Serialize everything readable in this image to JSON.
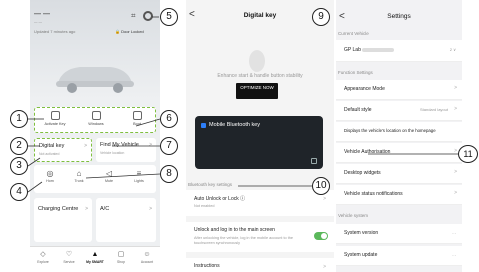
{
  "phone1": {
    "big_title": "— —",
    "subtitle": "— —",
    "updated": "Updated 7 minutes ago",
    "door_status": "Door Locked",
    "quick_actions": [
      {
        "label": "Activate Key",
        "icon": "lock-icon"
      },
      {
        "label": "Windows",
        "icon": "window-icon"
      },
      {
        "label": "Boot",
        "icon": "boot-icon"
      }
    ],
    "digital_key": {
      "title": "Digital key",
      "sub": "Not activated",
      "chevron": ">"
    },
    "find_vehicle": {
      "title": "Find My Vehicle",
      "sub": "Vehicle location",
      "chevron": ">"
    },
    "controls": [
      {
        "label": "Horn",
        "icon": "horn-icon",
        "glyph": "◎"
      },
      {
        "label": "Trunk",
        "icon": "trunk-icon",
        "glyph": "⌂"
      },
      {
        "label": "Mute",
        "icon": "speaker-icon",
        "glyph": "◁"
      },
      {
        "label": "Lights",
        "icon": "lights-icon",
        "glyph": "≡"
      }
    ],
    "charging": {
      "title": "Charging Centre",
      "chevron": ">"
    },
    "ac": {
      "title": "A/C",
      "chevron": ">"
    },
    "tabs": [
      {
        "label": "Explore",
        "glyph": "◇"
      },
      {
        "label": "Service",
        "glyph": "♡"
      },
      {
        "label": "My SMART",
        "glyph": "▲",
        "active": true
      },
      {
        "label": "Shop",
        "glyph": "▢"
      },
      {
        "label": "Account",
        "glyph": "☺"
      }
    ]
  },
  "phone2": {
    "back": "<",
    "title": "Digital key",
    "more": "⋯",
    "enhance_text": "Enhance start & handle button stability",
    "optimize_label": "OPTIMIZE NOW",
    "card_label": "Mobile Bluetooth key",
    "section": "Bluetooth key settings",
    "auto_unlock": {
      "title": "Auto Unlock or Lock",
      "sub": "Not enabled",
      "chevron": ">"
    },
    "unlock_screen": {
      "title": "Unlock and log in to the main screen",
      "sub": "After unlocking the vehicle, log in the mobile account to the touchscreen synchronously"
    },
    "instructions": {
      "title": "Instructions",
      "chevron": ">"
    }
  },
  "phone3": {
    "back": "<",
    "title": "Settings",
    "current_vehicle_hdr": "Current Vehicle",
    "vehicle_label": "GP Lab",
    "vehicle_count": "2 ∨",
    "function_hdr": "Function Settings",
    "rows": [
      {
        "label": "Appearance Mode",
        "value": ""
      },
      {
        "label": "Default style",
        "value": "Standard layout"
      },
      {
        "label": "Displays the vehicle's location on the homepage",
        "value": ""
      },
      {
        "label": "Vehicle Authorisation",
        "value": ""
      },
      {
        "label": "Desktop widgets",
        "value": ""
      },
      {
        "label": "Vehicle status notifications",
        "value": ""
      }
    ],
    "system_hdr": "Vehicle system",
    "system_rows": [
      {
        "label": "System version",
        "value": "- -"
      },
      {
        "label": "System update",
        "value": "- -"
      }
    ]
  },
  "callouts": [
    "1",
    "2",
    "3",
    "4",
    "5",
    "6",
    "7",
    "8",
    "9",
    "10",
    "11"
  ],
  "colors": {
    "dash_green": "#7fbf3f",
    "toggle_green": "#5bb85b",
    "card_dark": "#1f2429",
    "badge_blue": "#2d7ff9"
  }
}
